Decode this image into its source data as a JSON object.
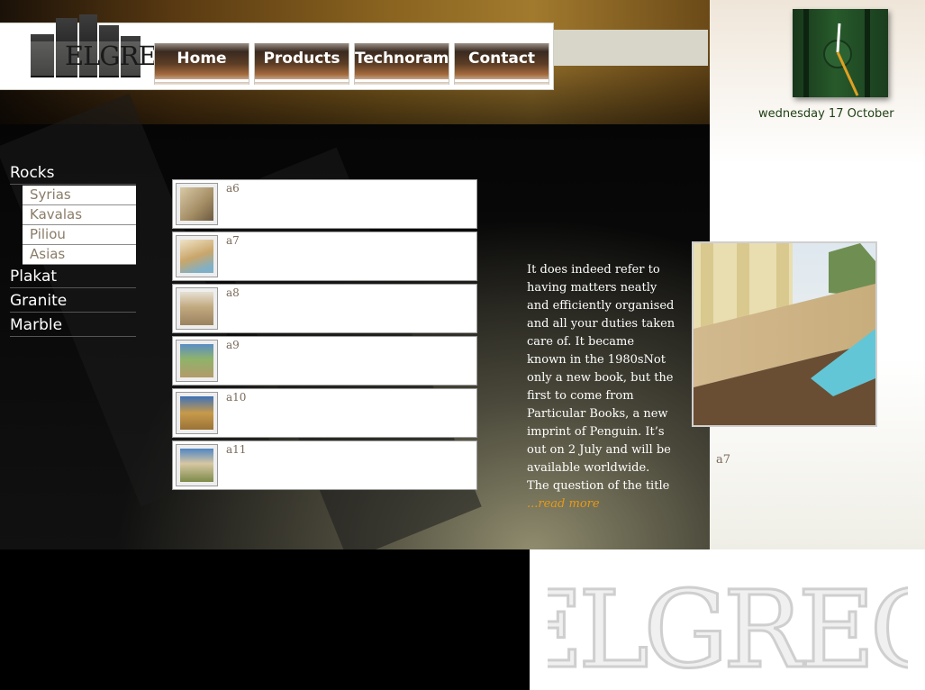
{
  "brand": {
    "logo_text": "ELGREG",
    "watermark_text": "ELGREG"
  },
  "nav": [
    {
      "label": "Home"
    },
    {
      "label": "Products"
    },
    {
      "label": "Technorama"
    },
    {
      "label": "Contact"
    }
  ],
  "date": "wednesday 17 October",
  "sidebar": {
    "categories": [
      {
        "label": "Rocks"
      },
      {
        "label": "Plakat"
      },
      {
        "label": "Granite"
      },
      {
        "label": "Marble"
      }
    ],
    "rocks_sub": [
      {
        "label": "Syrias"
      },
      {
        "label": "Kavalas"
      },
      {
        "label": "Piliou"
      },
      {
        "label": "Asias"
      }
    ]
  },
  "products": [
    {
      "label": "a6"
    },
    {
      "label": "a7"
    },
    {
      "label": "a8"
    },
    {
      "label": "a9"
    },
    {
      "label": "a10"
    },
    {
      "label": "a11"
    }
  ],
  "article": {
    "text": "It does indeed refer to having matters neatly and efficiently organised and all your duties taken care of. It became known in the 1980sNot only a new book, but the first to come from Particular Books, a new imprint of Penguin. It’s out on 2 July and will be available worldwide. The question of the title",
    "read_more": "...read more"
  },
  "featured": {
    "caption": "a7"
  },
  "colors": {
    "accent": "#e89a16",
    "date_text": "#1d3f12",
    "product_label": "#7b6a5a",
    "sub_item": "#8a7c68"
  }
}
